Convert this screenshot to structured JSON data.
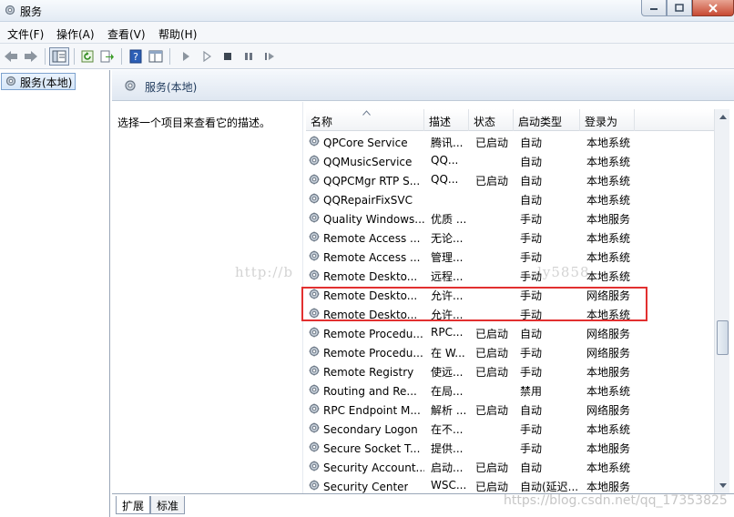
{
  "window": {
    "title": "服务"
  },
  "menu": {
    "items": [
      "文件(F)",
      "操作(A)",
      "查看(V)",
      "帮助(H)"
    ]
  },
  "tree": {
    "node_label": "服务(本地)"
  },
  "right_header": {
    "title": "服务(本地)"
  },
  "description": {
    "text": "选择一个项目来查看它的描述。"
  },
  "columns": [
    "名称",
    "描述",
    "状态",
    "启动类型",
    "登录为"
  ],
  "rows": [
    {
      "name": "QPCore Service",
      "desc": "腾讯...",
      "status": "已启动",
      "startup": "自动",
      "logon": "本地系统"
    },
    {
      "name": "QQMusicService",
      "desc": "QQ...",
      "status": "",
      "startup": "自动",
      "logon": "本地系统"
    },
    {
      "name": "QQPCMgr RTP S...",
      "desc": "QQ...",
      "status": "已启动",
      "startup": "自动",
      "logon": "本地系统"
    },
    {
      "name": "QQRepairFixSVC",
      "desc": "",
      "status": "",
      "startup": "自动",
      "logon": "本地系统"
    },
    {
      "name": "Quality Windows...",
      "desc": "优质 ...",
      "status": "",
      "startup": "手动",
      "logon": "本地服务"
    },
    {
      "name": "Remote Access ...",
      "desc": "无论...",
      "status": "",
      "startup": "手动",
      "logon": "本地系统"
    },
    {
      "name": "Remote Access ...",
      "desc": "管理...",
      "status": "",
      "startup": "手动",
      "logon": "本地系统"
    },
    {
      "name": "Remote Deskto...",
      "desc": "远程...",
      "status": "",
      "startup": "手动",
      "logon": "本地系统"
    },
    {
      "name": "Remote Deskto...",
      "desc": "允许...",
      "status": "",
      "startup": "手动",
      "logon": "网络服务"
    },
    {
      "name": "Remote Deskto...",
      "desc": "允许...",
      "status": "",
      "startup": "手动",
      "logon": "本地系统"
    },
    {
      "name": "Remote Procedu...",
      "desc": "RPC...",
      "status": "已启动",
      "startup": "自动",
      "logon": "网络服务"
    },
    {
      "name": "Remote Procedu...",
      "desc": "在 W...",
      "status": "已启动",
      "startup": "手动",
      "logon": "网络服务"
    },
    {
      "name": "Remote Registry",
      "desc": "使远...",
      "status": "已启动",
      "startup": "手动",
      "logon": "本地服务"
    },
    {
      "name": "Routing and Re...",
      "desc": "在局...",
      "status": "",
      "startup": "禁用",
      "logon": "本地系统"
    },
    {
      "name": "RPC Endpoint M...",
      "desc": "解析 ...",
      "status": "已启动",
      "startup": "自动",
      "logon": "网络服务"
    },
    {
      "name": "Secondary Logon",
      "desc": "在不...",
      "status": "",
      "startup": "手动",
      "logon": "本地系统"
    },
    {
      "name": "Secure Socket T...",
      "desc": "提供...",
      "status": "",
      "startup": "手动",
      "logon": "本地服务"
    },
    {
      "name": "Security Account...",
      "desc": "启动...",
      "status": "已启动",
      "startup": "自动",
      "logon": "本地系统"
    },
    {
      "name": "Security Center",
      "desc": "WSC...",
      "status": "已启动",
      "startup": "自动(延迟...",
      "logon": "本地服务"
    }
  ],
  "tabs": [
    "扩展",
    "标准"
  ],
  "watermarks": [
    "http://b",
    "ly5858",
    "https://blog.csdn.net/qq_17353825"
  ],
  "colors": {
    "highlight": "#e23030",
    "header_bg": "#dfe7f1"
  },
  "icons": [
    "services-icon",
    "back-icon",
    "forward-icon",
    "console-tree-icon",
    "refresh-icon",
    "export-icon",
    "help-icon",
    "properties-icon",
    "play-icon",
    "pause-icon",
    "stop-icon",
    "resume-icon",
    "gear-icon"
  ]
}
